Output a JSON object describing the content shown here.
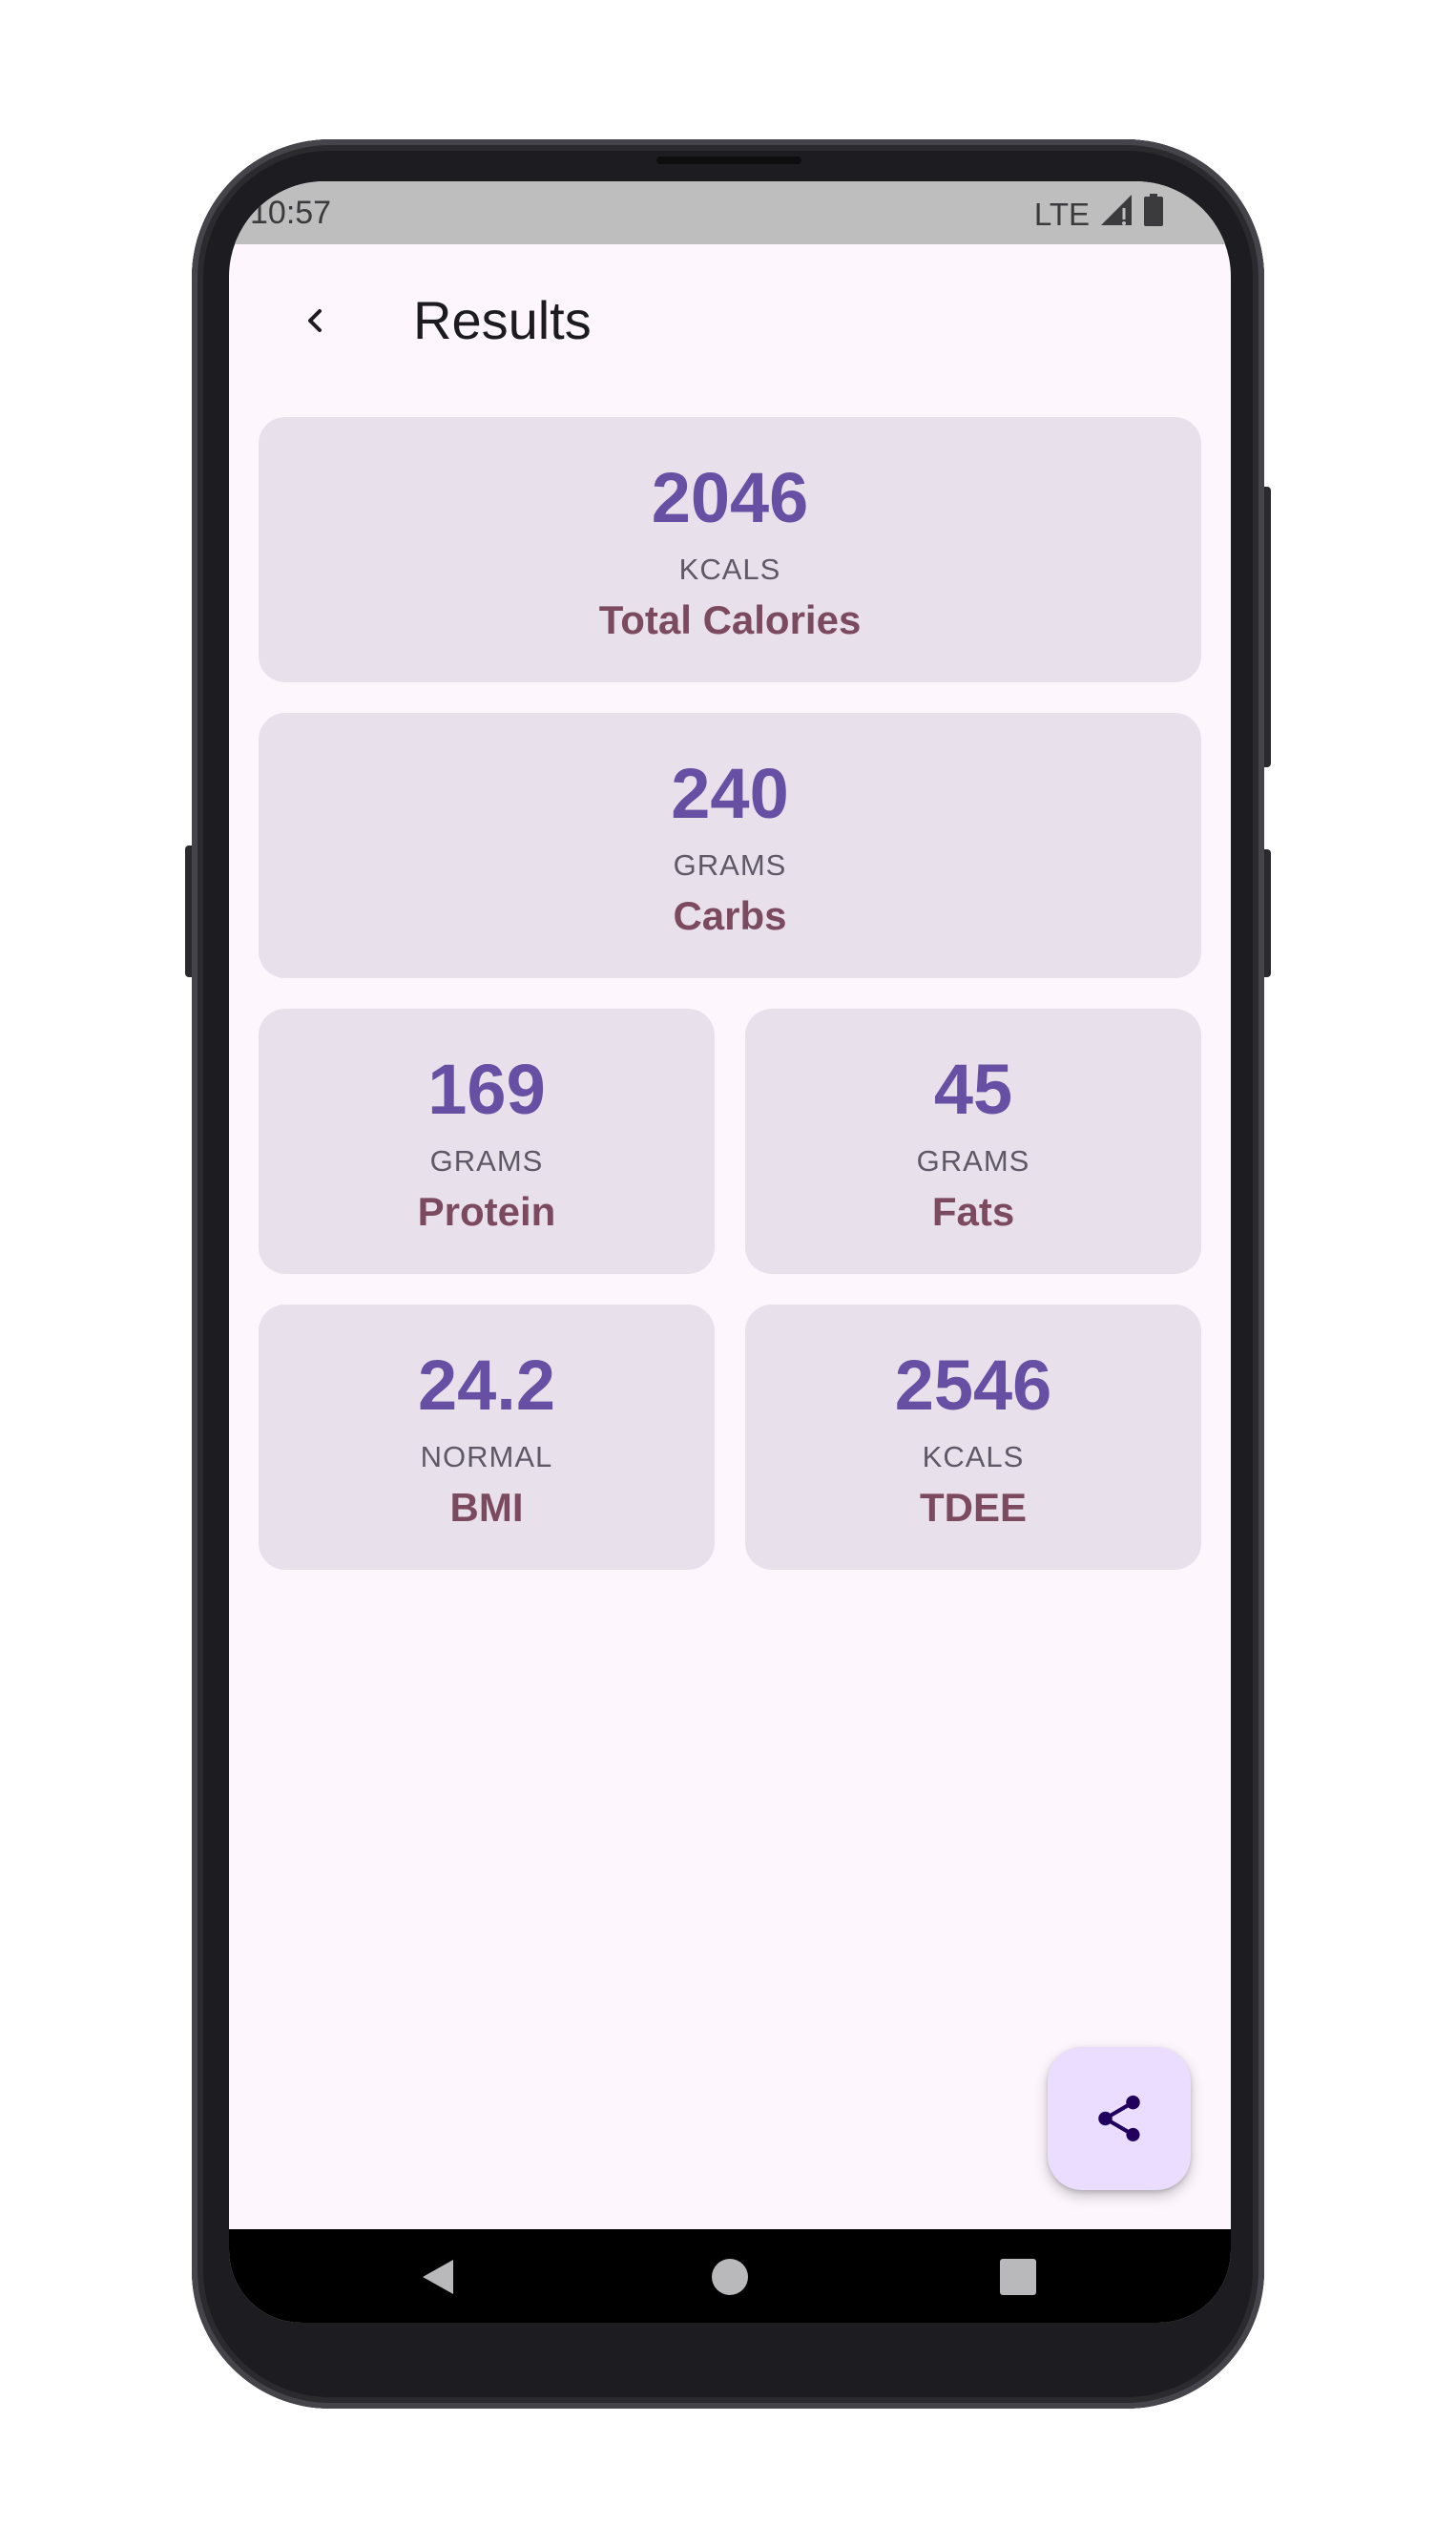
{
  "status_bar": {
    "time": "10:57",
    "network": "LTE",
    "icons": [
      "signal-icon",
      "battery-icon"
    ]
  },
  "app_bar": {
    "title": "Results",
    "back_icon": "chevron-left-icon"
  },
  "results": {
    "total_calories": {
      "value": "2046",
      "unit": "KCALS",
      "label": "Total Calories"
    },
    "carbs": {
      "value": "240",
      "unit": "GRAMS",
      "label": "Carbs"
    },
    "protein": {
      "value": "169",
      "unit": "GRAMS",
      "label": "Protein"
    },
    "fats": {
      "value": "45",
      "unit": "GRAMS",
      "label": "Fats"
    },
    "bmi": {
      "value": "24.2",
      "unit": "NORMAL",
      "label": "BMI"
    },
    "tdee": {
      "value": "2546",
      "unit": "KCALS",
      "label": "TDEE"
    }
  },
  "fab": {
    "icon": "share-icon"
  },
  "nav_bar": {
    "icons": [
      "nav-back-icon",
      "nav-home-icon",
      "nav-recents-icon"
    ]
  },
  "colors": {
    "value": "#674fa3",
    "unit": "#5f5867",
    "label": "#7c4a5e",
    "card_bg": "#e8e0eb",
    "screen_bg": "#fdf7fd",
    "fab_bg": "#eaddff"
  }
}
